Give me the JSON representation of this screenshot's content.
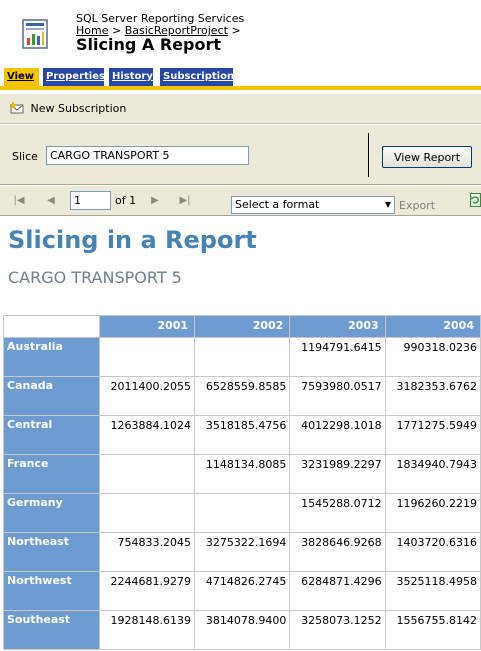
{
  "header": {
    "app_name": "SQL Server Reporting Services",
    "breadcrumb": {
      "home": "Home",
      "separator": ">",
      "project": "BasicReportProject",
      "trailing": ">"
    },
    "report_title": "Slicing A Report"
  },
  "tabs": [
    {
      "label": "View",
      "active": true
    },
    {
      "label": "Properties",
      "active": false
    },
    {
      "label": "History",
      "active": false
    },
    {
      "label": "Subscriptions",
      "active": false
    }
  ],
  "toolbar": {
    "new_subscription": "New Subscription"
  },
  "parameters": {
    "slice_label": "Slice",
    "slice_value": "CARGO TRANSPORT 5",
    "view_report_label": "View Report"
  },
  "navigation": {
    "page_value": "1",
    "of_text": "of 1",
    "format_select": "Select a format",
    "export_label": "Export"
  },
  "report": {
    "title": "Slicing in a Report",
    "subtitle": "CARGO TRANSPORT 5",
    "columns": [
      "2001",
      "2002",
      "2003",
      "2004"
    ],
    "rows": [
      {
        "name": "Australia",
        "values": [
          "",
          "",
          "1194791.6415",
          "990318.0236"
        ]
      },
      {
        "name": "Canada",
        "values": [
          "2011400.2055",
          "6528559.8585",
          "7593980.0517",
          "3182353.6762"
        ]
      },
      {
        "name": "Central",
        "values": [
          "1263884.1024",
          "3518185.4756",
          "4012298.1018",
          "1771275.5949"
        ]
      },
      {
        "name": "France",
        "values": [
          "",
          "1148134.8085",
          "3231989.2297",
          "1834940.7943"
        ]
      },
      {
        "name": "Germany",
        "values": [
          "",
          "",
          "1545288.0712",
          "1196260.2219"
        ]
      },
      {
        "name": "Northeast",
        "values": [
          "754833.2045",
          "3275322.1694",
          "3828646.9268",
          "1403720.6316"
        ]
      },
      {
        "name": "Northwest",
        "values": [
          "2244681.9279",
          "4714826.2745",
          "6284871.4296",
          "3525118.4958"
        ]
      },
      {
        "name": "Southeast",
        "values": [
          "1928148.6139",
          "3814078.9400",
          "3258073.1252",
          "1556755.8142"
        ]
      }
    ]
  },
  "colors": {
    "tab_blue": "#2747a8",
    "tab_active": "#f5c400",
    "toolbar_bg": "#ece9d8",
    "report_title": "#4682b4",
    "matrix_header": "#6e9cd1"
  },
  "icons": {
    "app": "report-icon",
    "new_subscription": "new-subscription-icon",
    "refresh": "refresh-icon"
  }
}
